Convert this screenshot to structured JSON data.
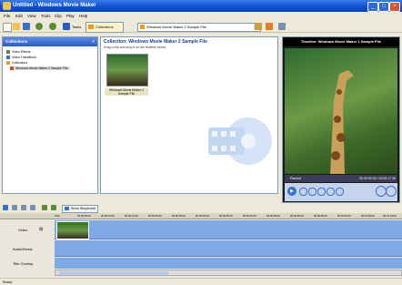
{
  "window": {
    "title": "Untitled - Windows Movie Maker"
  },
  "menu": [
    "File",
    "Edit",
    "View",
    "Tools",
    "Clip",
    "Play",
    "Help"
  ],
  "toolbar": {
    "tasks_label": "Tasks",
    "collections_label": "Collections",
    "collection_combo_value": "Windows Movie Maker 2 Sample File"
  },
  "collections_pane": {
    "header": "Collections",
    "items": [
      "Video Effects",
      "Video Transitions",
      "Collections",
      "Windows Movie Maker 2 Sample File"
    ]
  },
  "content_pane": {
    "title": "Collection: Windows Movie Maker 2 Sample File",
    "hint": "Drag a clip and drop it on the timeline below.",
    "clip_label": "Windows Movie Maker 2 Sample File"
  },
  "preview": {
    "header": "Timeline: Windows Movie Maker 2 Sample File",
    "status": "Paused",
    "time": "00:00:00.00 / 00:00:17.36"
  },
  "timeline": {
    "show_storyboard": "Show Storyboard",
    "rows": [
      "Video",
      "Audio/Music",
      "Title Overlay"
    ],
    "ticks": [
      "0:00",
      "00:00:05.00",
      "00:00:10.00",
      "00:00:15.00",
      "00:00:20.00",
      "00:00:25.00",
      "00:00:30.00",
      "00:00:35.00",
      "00:00:40.00",
      "00:00:45.00",
      "00:00:50.00",
      "00:00:55.00",
      "00:01:00.00",
      "00:01:05.00",
      "00:01:10.00"
    ]
  },
  "statusbar": {
    "text": "Ready"
  }
}
